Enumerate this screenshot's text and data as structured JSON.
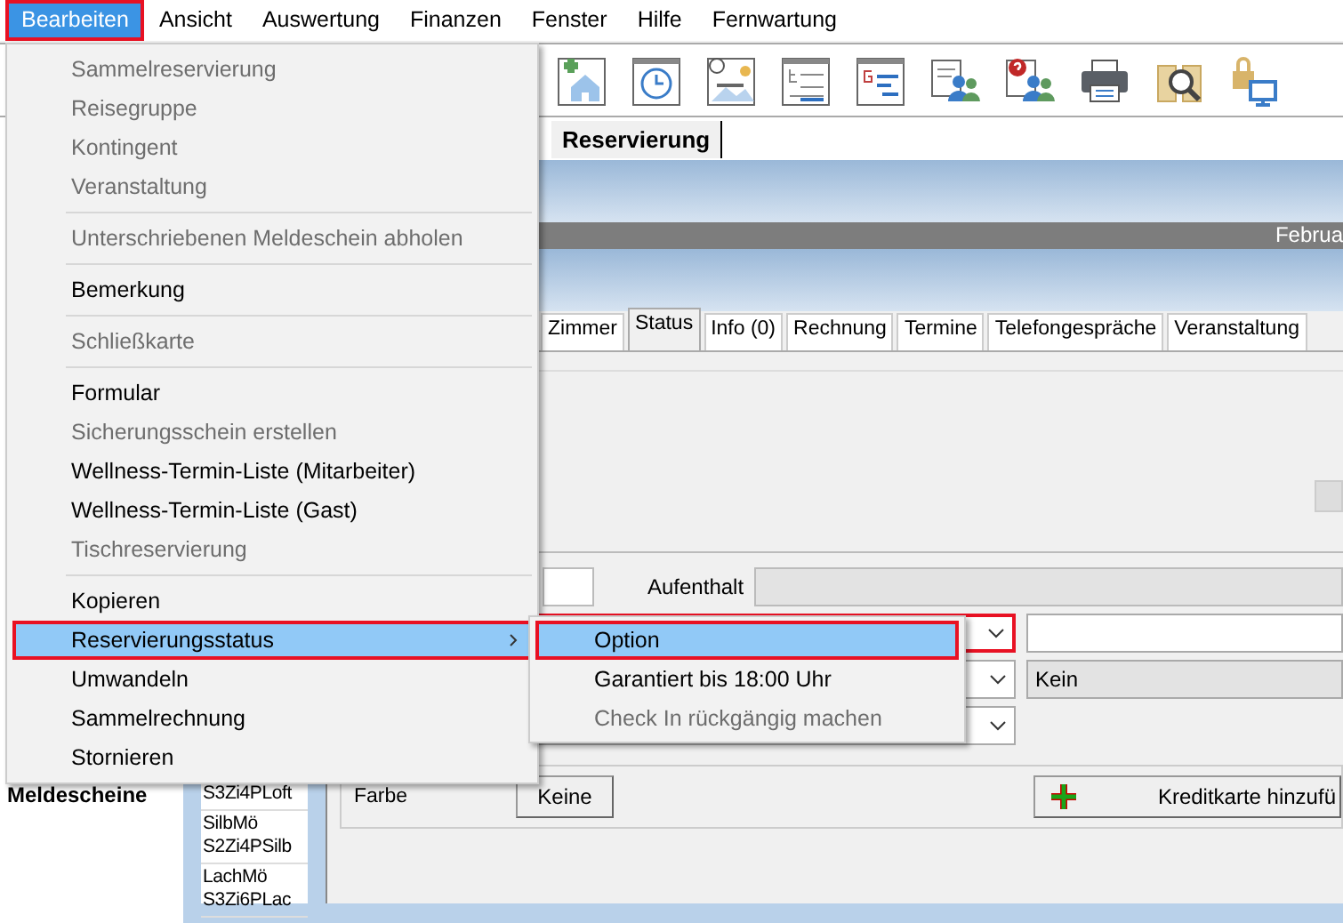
{
  "menubar": [
    {
      "label": "Bearbeiten",
      "selected": true
    },
    {
      "label": "Ansicht",
      "selected": false
    },
    {
      "label": "Auswertung",
      "selected": false
    },
    {
      "label": "Finanzen",
      "selected": false
    },
    {
      "label": "Fenster",
      "selected": false
    },
    {
      "label": "Hilfe",
      "selected": false
    },
    {
      "label": "Fernwartung",
      "selected": false
    }
  ],
  "document_tabs": [
    {
      "label": "Reservierung",
      "selected": true
    }
  ],
  "timeline": {
    "month": "Februa"
  },
  "tabs": [
    {
      "label": "Zimmer",
      "selected": false
    },
    {
      "label": "Status",
      "selected": true
    },
    {
      "label": "Info (0)",
      "selected": false
    },
    {
      "label": "Rechnung",
      "selected": false
    },
    {
      "label": "Termine",
      "selected": false
    },
    {
      "label": "Telefongespräche",
      "selected": false
    },
    {
      "label": "Veranstaltung",
      "selected": false
    }
  ],
  "form": {
    "stay_label": "Aufenthalt",
    "status_combo": {
      "highlighted": true
    },
    "second_value": "Kein",
    "color_label": "Farbe",
    "color_button": "Keine",
    "credit_card_button": "Kreditkarte hinzufü"
  },
  "room_list": [
    {
      "lines": [
        "S3Zi4PLoft"
      ]
    },
    {
      "lines": [
        "SilbMö",
        "S2Zi4PSilb"
      ]
    },
    {
      "lines": [
        "LachMö",
        "S3Zi6PLac"
      ]
    }
  ],
  "left_panel": {
    "label": "Meldescheine"
  },
  "edit_menu": {
    "items": [
      {
        "kind": "item",
        "label": "Sammelreservierung",
        "disabled": true,
        "selected": false,
        "has_submenu": false
      },
      {
        "kind": "item",
        "label": "Reisegruppe",
        "disabled": true,
        "selected": false,
        "has_submenu": false
      },
      {
        "kind": "item",
        "label": "Kontingent",
        "disabled": true,
        "selected": false,
        "has_submenu": false
      },
      {
        "kind": "item",
        "label": "Veranstaltung",
        "disabled": true,
        "selected": false,
        "has_submenu": false
      },
      {
        "kind": "separator"
      },
      {
        "kind": "item",
        "label": "Unterschriebenen Meldeschein abholen",
        "disabled": true,
        "selected": false,
        "has_submenu": false
      },
      {
        "kind": "separator"
      },
      {
        "kind": "item",
        "label": "Bemerkung",
        "disabled": false,
        "selected": false,
        "has_submenu": false
      },
      {
        "kind": "separator"
      },
      {
        "kind": "item",
        "label": "Schließkarte",
        "disabled": true,
        "selected": false,
        "has_submenu": false
      },
      {
        "kind": "separator"
      },
      {
        "kind": "item",
        "label": "Formular",
        "disabled": false,
        "selected": false,
        "has_submenu": false
      },
      {
        "kind": "item",
        "label": "Sicherungsschein erstellen",
        "disabled": true,
        "selected": false,
        "has_submenu": false
      },
      {
        "kind": "item",
        "label": "Wellness-Termin-Liste (Mitarbeiter)",
        "disabled": false,
        "selected": false,
        "has_submenu": false
      },
      {
        "kind": "item",
        "label": "Wellness-Termin-Liste (Gast)",
        "disabled": false,
        "selected": false,
        "has_submenu": false
      },
      {
        "kind": "item",
        "label": "Tischreservierung",
        "disabled": true,
        "selected": false,
        "has_submenu": false
      },
      {
        "kind": "separator"
      },
      {
        "kind": "item",
        "label": "Kopieren",
        "disabled": false,
        "selected": false,
        "has_submenu": false
      },
      {
        "kind": "item",
        "label": "Reservierungsstatus",
        "disabled": false,
        "selected": true,
        "has_submenu": true
      },
      {
        "kind": "item",
        "label": "Umwandeln",
        "disabled": false,
        "selected": false,
        "has_submenu": false
      },
      {
        "kind": "item",
        "label": "Sammelrechnung",
        "disabled": false,
        "selected": false,
        "has_submenu": false
      },
      {
        "kind": "item",
        "label": "Stornieren",
        "disabled": false,
        "selected": false,
        "has_submenu": false
      }
    ]
  },
  "status_submenu": {
    "items": [
      {
        "kind": "item",
        "label": "Option",
        "disabled": false,
        "selected": true,
        "has_submenu": false
      },
      {
        "kind": "item",
        "label": "Garantiert bis 18:00 Uhr",
        "disabled": false,
        "selected": false,
        "has_submenu": false
      },
      {
        "kind": "item",
        "label": "Check In rückgängig machen",
        "disabled": true,
        "selected": false,
        "has_submenu": false
      }
    ]
  }
}
